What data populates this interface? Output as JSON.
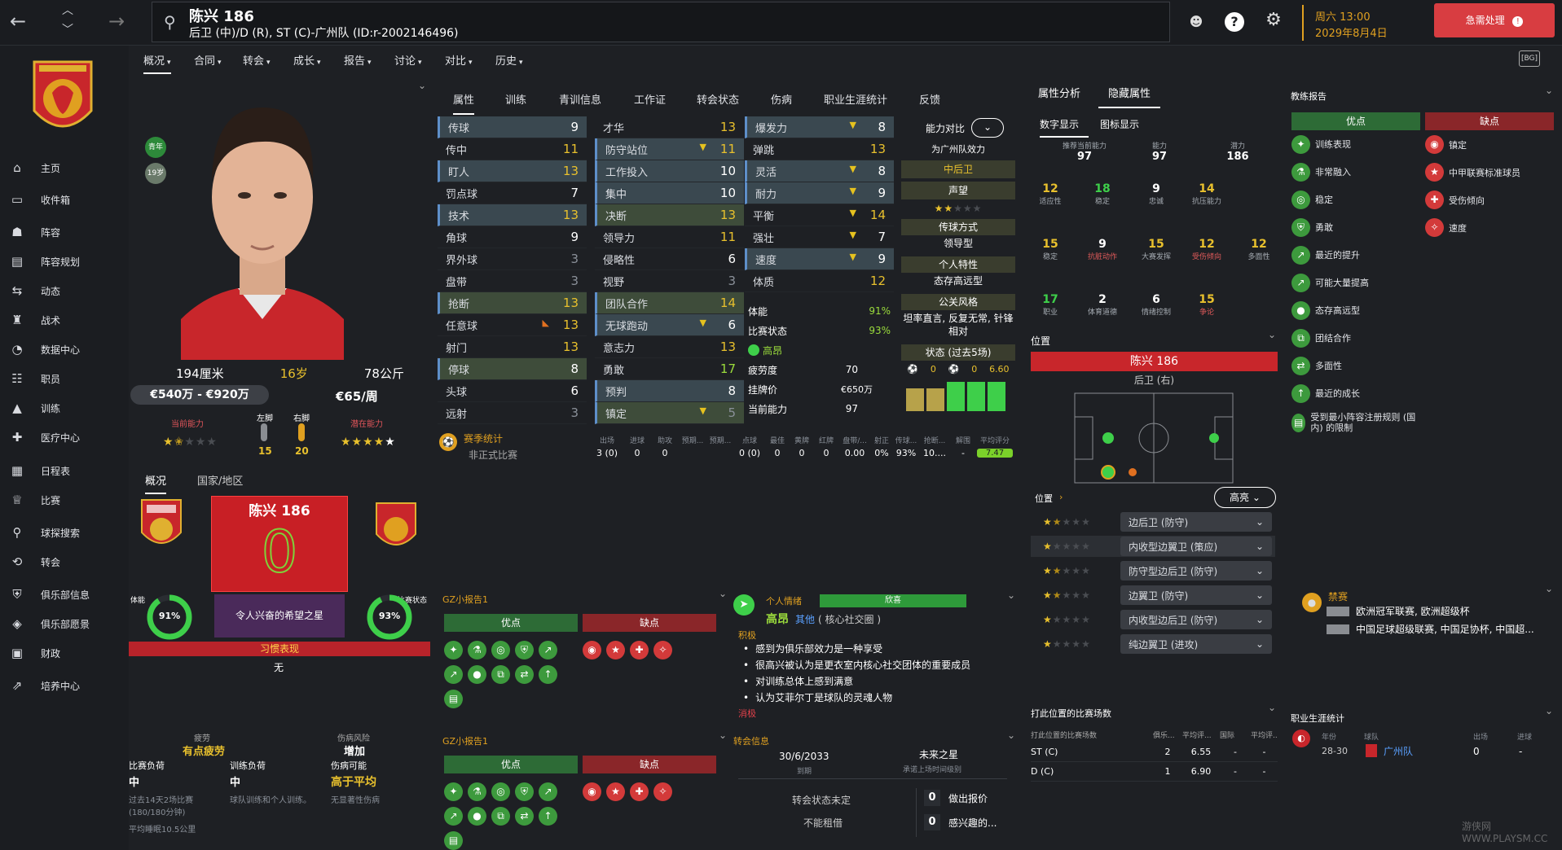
{
  "topbar": {
    "player_name": "陈兴 186",
    "player_desc": "后卫 (中)/D (R), ST (C)-广州队 (ID:r-2002146496)",
    "date_day": "周六 13:00",
    "date_full": "2029年8月4日",
    "urgent_label": "急需处理"
  },
  "sidebar": {
    "items": [
      {
        "label": "主页",
        "icon": "home-icon"
      },
      {
        "label": "收件箱",
        "icon": "inbox-icon"
      },
      {
        "label": "阵容",
        "icon": "squad-icon"
      },
      {
        "label": "阵容规划",
        "icon": "planner-icon"
      },
      {
        "label": "动态",
        "icon": "dynamics-icon"
      },
      {
        "label": "战术",
        "icon": "tactics-icon"
      },
      {
        "label": "数据中心",
        "icon": "data-icon"
      },
      {
        "label": "职员",
        "icon": "staff-icon"
      },
      {
        "label": "训练",
        "icon": "training-icon"
      },
      {
        "label": "医疗中心",
        "icon": "medical-icon"
      },
      {
        "label": "日程表",
        "icon": "calendar-icon"
      },
      {
        "label": "比赛",
        "icon": "trophy-icon"
      },
      {
        "label": "球探搜索",
        "icon": "scout-icon"
      },
      {
        "label": "转会",
        "icon": "transfer-icon"
      },
      {
        "label": "俱乐部信息",
        "icon": "club-icon"
      },
      {
        "label": "俱乐部愿景",
        "icon": "vision-icon"
      },
      {
        "label": "财政",
        "icon": "finance-icon"
      },
      {
        "label": "培养中心",
        "icon": "development-icon"
      }
    ]
  },
  "submenu": [
    "概况",
    "合同",
    "转会",
    "成长",
    "报告",
    "讨论",
    "对比",
    "历史"
  ],
  "profile": {
    "badge_youth": "青年",
    "badge_u19": "19岁",
    "height": "194厘米",
    "age": "16岁",
    "weight": "78公斤",
    "value": "€540万 - €920万",
    "wage": "€65/周",
    "current_ability_label": "当前能力",
    "left_foot_label": "左脚",
    "right_foot_label": "右脚",
    "potential_label": "潜在能力",
    "left_foot": "15",
    "right_foot": "20",
    "tab_overview": "概况",
    "tab_nation": "国家/地区",
    "card_name": "陈兴 186",
    "card_number": "0",
    "card_desc": "令人兴奋的希望之星",
    "condition_label": "体能",
    "condition_pct": "91%",
    "form_label": "比赛状态",
    "form_pct": "93%",
    "habit_label": "习惯表现",
    "habit_value": "无"
  },
  "fatigue": {
    "label": "疲劳",
    "value": "有点疲劳",
    "injury_risk_label": "伤病风险",
    "injury_risk_value": "增加",
    "match_load_label": "比赛负荷",
    "match_load_value": "中",
    "training_load_label": "训练负荷",
    "training_load_value": "中",
    "injury_chance_label": "伤病可能",
    "injury_chance_value": "高于平均",
    "note1": "过去14天2场比赛",
    "note1b": "(180/180分钟)",
    "note2": "平均睡眠10.5公里",
    "note3": "球队训练和个人训练。",
    "note4": "无显著性伤病"
  },
  "attr_tabs": [
    "属性",
    "训练",
    "青训信息",
    "工作证",
    "转会状态",
    "伤病",
    "职业生涯统计",
    "反馈"
  ],
  "technical": [
    {
      "n": "传球",
      "v": "9"
    },
    {
      "n": "传中",
      "v": "11"
    },
    {
      "n": "盯人",
      "v": "13"
    },
    {
      "n": "罚点球",
      "v": "7"
    },
    {
      "n": "技术",
      "v": "13"
    },
    {
      "n": "角球",
      "v": "9"
    },
    {
      "n": "界外球",
      "v": "3"
    },
    {
      "n": "盘带",
      "v": "3"
    },
    {
      "n": "抢断",
      "v": "13"
    },
    {
      "n": "任意球",
      "v": "13"
    },
    {
      "n": "射门",
      "v": "13"
    },
    {
      "n": "停球",
      "v": "8"
    },
    {
      "n": "头球",
      "v": "6"
    },
    {
      "n": "远射",
      "v": "3"
    }
  ],
  "mental": [
    {
      "n": "才华",
      "v": "13"
    },
    {
      "n": "防守站位",
      "v": "11"
    },
    {
      "n": "工作投入",
      "v": "10"
    },
    {
      "n": "集中",
      "v": "10"
    },
    {
      "n": "决断",
      "v": "13"
    },
    {
      "n": "领导力",
      "v": "11"
    },
    {
      "n": "侵略性",
      "v": "6"
    },
    {
      "n": "视野",
      "v": "3"
    },
    {
      "n": "团队合作",
      "v": "14"
    },
    {
      "n": "无球跑动",
      "v": "6"
    },
    {
      "n": "意志力",
      "v": "13"
    },
    {
      "n": "勇敢",
      "v": "17"
    },
    {
      "n": "预判",
      "v": "8"
    },
    {
      "n": "镇定",
      "v": "5"
    }
  ],
  "physical": [
    {
      "n": "爆发力",
      "v": "8"
    },
    {
      "n": "弹跳",
      "v": "13"
    },
    {
      "n": "灵活",
      "v": "8"
    },
    {
      "n": "耐力",
      "v": "9"
    },
    {
      "n": "平衡",
      "v": "14"
    },
    {
      "n": "强壮",
      "v": "7"
    },
    {
      "n": "速度",
      "v": "9"
    },
    {
      "n": "体质",
      "v": "12"
    }
  ],
  "phys_extra": {
    "stamina_label": "体能",
    "stamina_val": "91%",
    "form_label": "比赛状态",
    "form_val": "93%",
    "morale_label": "高昂",
    "fatigue_label": "疲劳度",
    "fatigue_val": "70",
    "asking_label": "挂牌价",
    "asking_val": "€650万",
    "ca_label": "当前能力",
    "ca_val": "97"
  },
  "compare": {
    "title": "能力对比",
    "role_team": "为广州队效力",
    "role": "中后卫",
    "rep_label": "声望",
    "style_label": "传球方式",
    "style_val": "领导型",
    "trait_label": "个人特性",
    "trait_val": "态存高远型",
    "media_label": "公关风格",
    "media_val": "坦率直言, 反复无常, 针锋相对",
    "form_title": "状态 (过去5场)",
    "goals": "0",
    "assists": "0",
    "rating": "6.60"
  },
  "season": {
    "title": "赛季统计",
    "headers": [
      "出场",
      "进球",
      "助攻",
      "预期...",
      "预期...",
      "点球",
      "最佳",
      "黄牌",
      "红牌",
      "盘带/...",
      "射正",
      "传球...",
      "抢断...",
      "解围",
      "平均评分"
    ],
    "row_label": "非正式比赛",
    "values": [
      "3 (0)",
      "0",
      "0",
      "",
      "",
      "0 (0)",
      "0",
      "0",
      "0",
      "0.00",
      "0%",
      "93%",
      "10....",
      "-",
      "7.47"
    ]
  },
  "report1": {
    "title": "GZ小报告1",
    "pros": "优点",
    "cons": "缺点"
  },
  "report2": {
    "title": "GZ小报告1",
    "pros": "优点",
    "cons": "缺点"
  },
  "mood": {
    "title": "个人情绪",
    "bar_label": "欣喜",
    "level": "高昂",
    "social": "其他",
    "social_desc": "( 核心社交圈 )",
    "positive_label": "积极",
    "lines": [
      "感到为俱乐部效力是一种享受",
      "很高兴被认为是更衣室内核心社交团体的重要成员",
      "对训练总体上感到满意",
      "认为艾菲尔丁是球队的灵魂人物"
    ],
    "negative_label": "消极"
  },
  "transfer": {
    "title": "转会信息",
    "contract_date": "30/6/2033",
    "contract_label": "到期",
    "future": "未来之星",
    "future_label": "承诺上场时间级别",
    "status": "转会状态未定",
    "loan": "不能租借",
    "offers_num": "0",
    "offers_label": "做出报价",
    "interest_num": "0",
    "interest_label": "感兴趣的..."
  },
  "hidden": {
    "tab1": "属性分析",
    "tab2": "隐藏属性",
    "sub1": "数字显示",
    "sub2": "图标显示",
    "top": [
      {
        "l": "推荐当前能力",
        "n": "97"
      },
      {
        "l": "能力",
        "n": "97"
      },
      {
        "l": "潜力",
        "n": "186"
      }
    ],
    "rows": [
      [
        {
          "n": "12",
          "l": "适应性",
          "c": "yellow"
        },
        {
          "n": "18",
          "l": "稳定",
          "c": "green"
        },
        {
          "n": "9",
          "l": "忠诚",
          "c": "white"
        },
        {
          "n": "14",
          "l": "抗压能力",
          "c": "yellow"
        }
      ],
      [
        {
          "n": "15",
          "l": "稳定",
          "c": "yellow"
        },
        {
          "n": "9",
          "l": "抗脏动作",
          "c": "white"
        },
        {
          "n": "15",
          "l": "大赛发挥",
          "c": "yellow"
        },
        {
          "n": "12",
          "l": "受伤倾向",
          "c": "yellow"
        },
        {
          "n": "12",
          "l": "多面性",
          "c": "yellow"
        }
      ],
      [
        {
          "n": "17",
          "l": "职业",
          "c": "green"
        },
        {
          "n": "2",
          "l": "体育道德",
          "c": "white"
        },
        {
          "n": "6",
          "l": "情绪控制",
          "c": "white"
        },
        {
          "n": "15",
          "l": "争论",
          "c": "yellow"
        }
      ]
    ]
  },
  "position": {
    "title": "位置",
    "player": "陈兴 186",
    "role": "后卫 (右)",
    "sub_title": "位置",
    "highlight": "高亮",
    "roles": [
      {
        "name": "边后卫 (防守)",
        "stars": 1.5
      },
      {
        "name": "内收型边翼卫 (策应)",
        "stars": 1
      },
      {
        "name": "防守型边后卫 (防守)",
        "stars": 1.5
      },
      {
        "name": "边翼卫 (防守)",
        "stars": 1.5
      },
      {
        "name": "内收型边后卫 (防守)",
        "stars": 1
      },
      {
        "name": "纯边翼卫 (进攻)",
        "stars": 1
      }
    ],
    "played_title": "打此位置的比赛场数",
    "played_headers": [
      "打此位置的比赛场数",
      "俱乐...",
      "平均评...",
      "国际",
      "平均评..."
    ],
    "played_rows": [
      {
        "pos": "ST (C)",
        "club": "2",
        "avg": "6.55",
        "intl": "-",
        "avg2": "-"
      },
      {
        "pos": "D (C)",
        "club": "1",
        "avg": "6.90",
        "intl": "-",
        "avg2": "-"
      }
    ]
  },
  "coach": {
    "title": "教练报告",
    "pros": "优点",
    "cons": "缺点",
    "pros_list": [
      "训练表现",
      "非常融入",
      "稳定",
      "勇敢",
      "最近的提升",
      "可能大量提高",
      "态存高远型",
      "团结合作",
      "多面性",
      "最近的成长",
      "受到最小阵容注册规则 (国内) 的限制"
    ],
    "cons_list": [
      "镇定",
      "中甲联赛标准球员",
      "受伤倾向",
      "速度"
    ]
  },
  "ban": {
    "title": "禁赛",
    "line1": "欧洲冠军联赛, 欧洲超级杯",
    "line2": "中国足球超级联赛, 中国足协杯, 中国超..."
  },
  "career": {
    "title": "职业生涯统计",
    "headers": [
      "年份",
      "球队",
      "出场",
      "进球"
    ],
    "year": "28-30",
    "team": "广州队",
    "apps": "0",
    "goals": "-"
  },
  "watermark": "游侠网 WWW.PLAYSM.CC"
}
